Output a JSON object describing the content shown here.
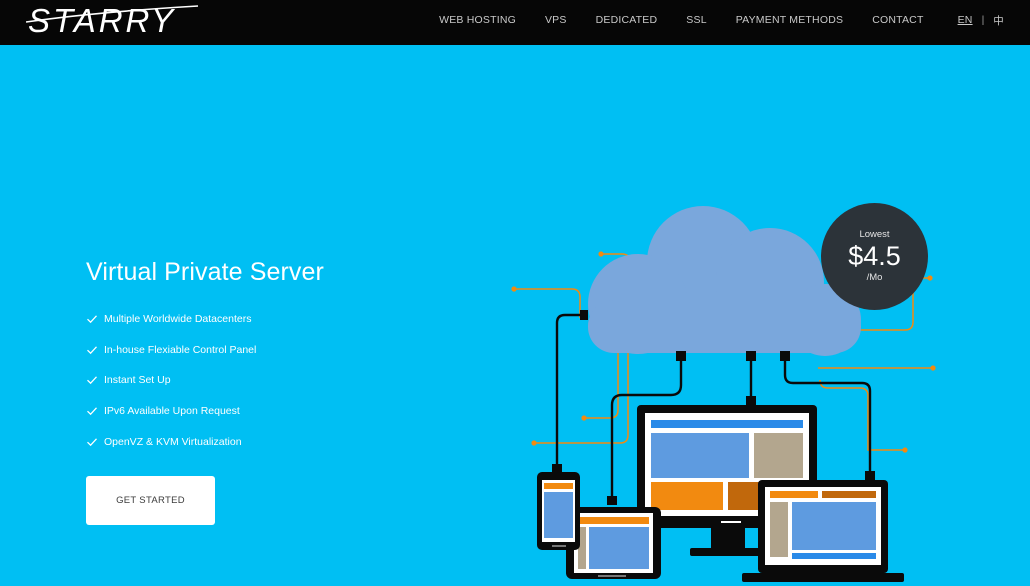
{
  "brand": {
    "logo_text": "STARRY"
  },
  "nav": {
    "items": [
      {
        "label": "WEB HOSTING"
      },
      {
        "label": "VPS"
      },
      {
        "label": "DEDICATED"
      },
      {
        "label": "SSL"
      },
      {
        "label": "PAYMENT METHODS"
      },
      {
        "label": "CONTACT"
      }
    ],
    "lang_en": "EN",
    "lang_sep": "|",
    "lang_zh": "中"
  },
  "hero": {
    "title": "Virtual Private Server",
    "features": [
      "Multiple Worldwide Datacenters",
      "In-house Flexiable Control Panel",
      "Instant Set Up",
      "IPv6 Available Upon Request",
      "OpenVZ & KVM Virtualization"
    ],
    "cta_label": "GET STARTED"
  },
  "price_badge": {
    "label": "Lowest",
    "amount": "$4.5",
    "period": "/Mo"
  },
  "colors": {
    "background": "#00bff3",
    "navbar": "#060606",
    "cloud": "#7aa7dc",
    "badge": "#2c3339",
    "screen_blue": "#5e9be0",
    "orange": "#f28a10",
    "khaki": "#b3a68e"
  }
}
